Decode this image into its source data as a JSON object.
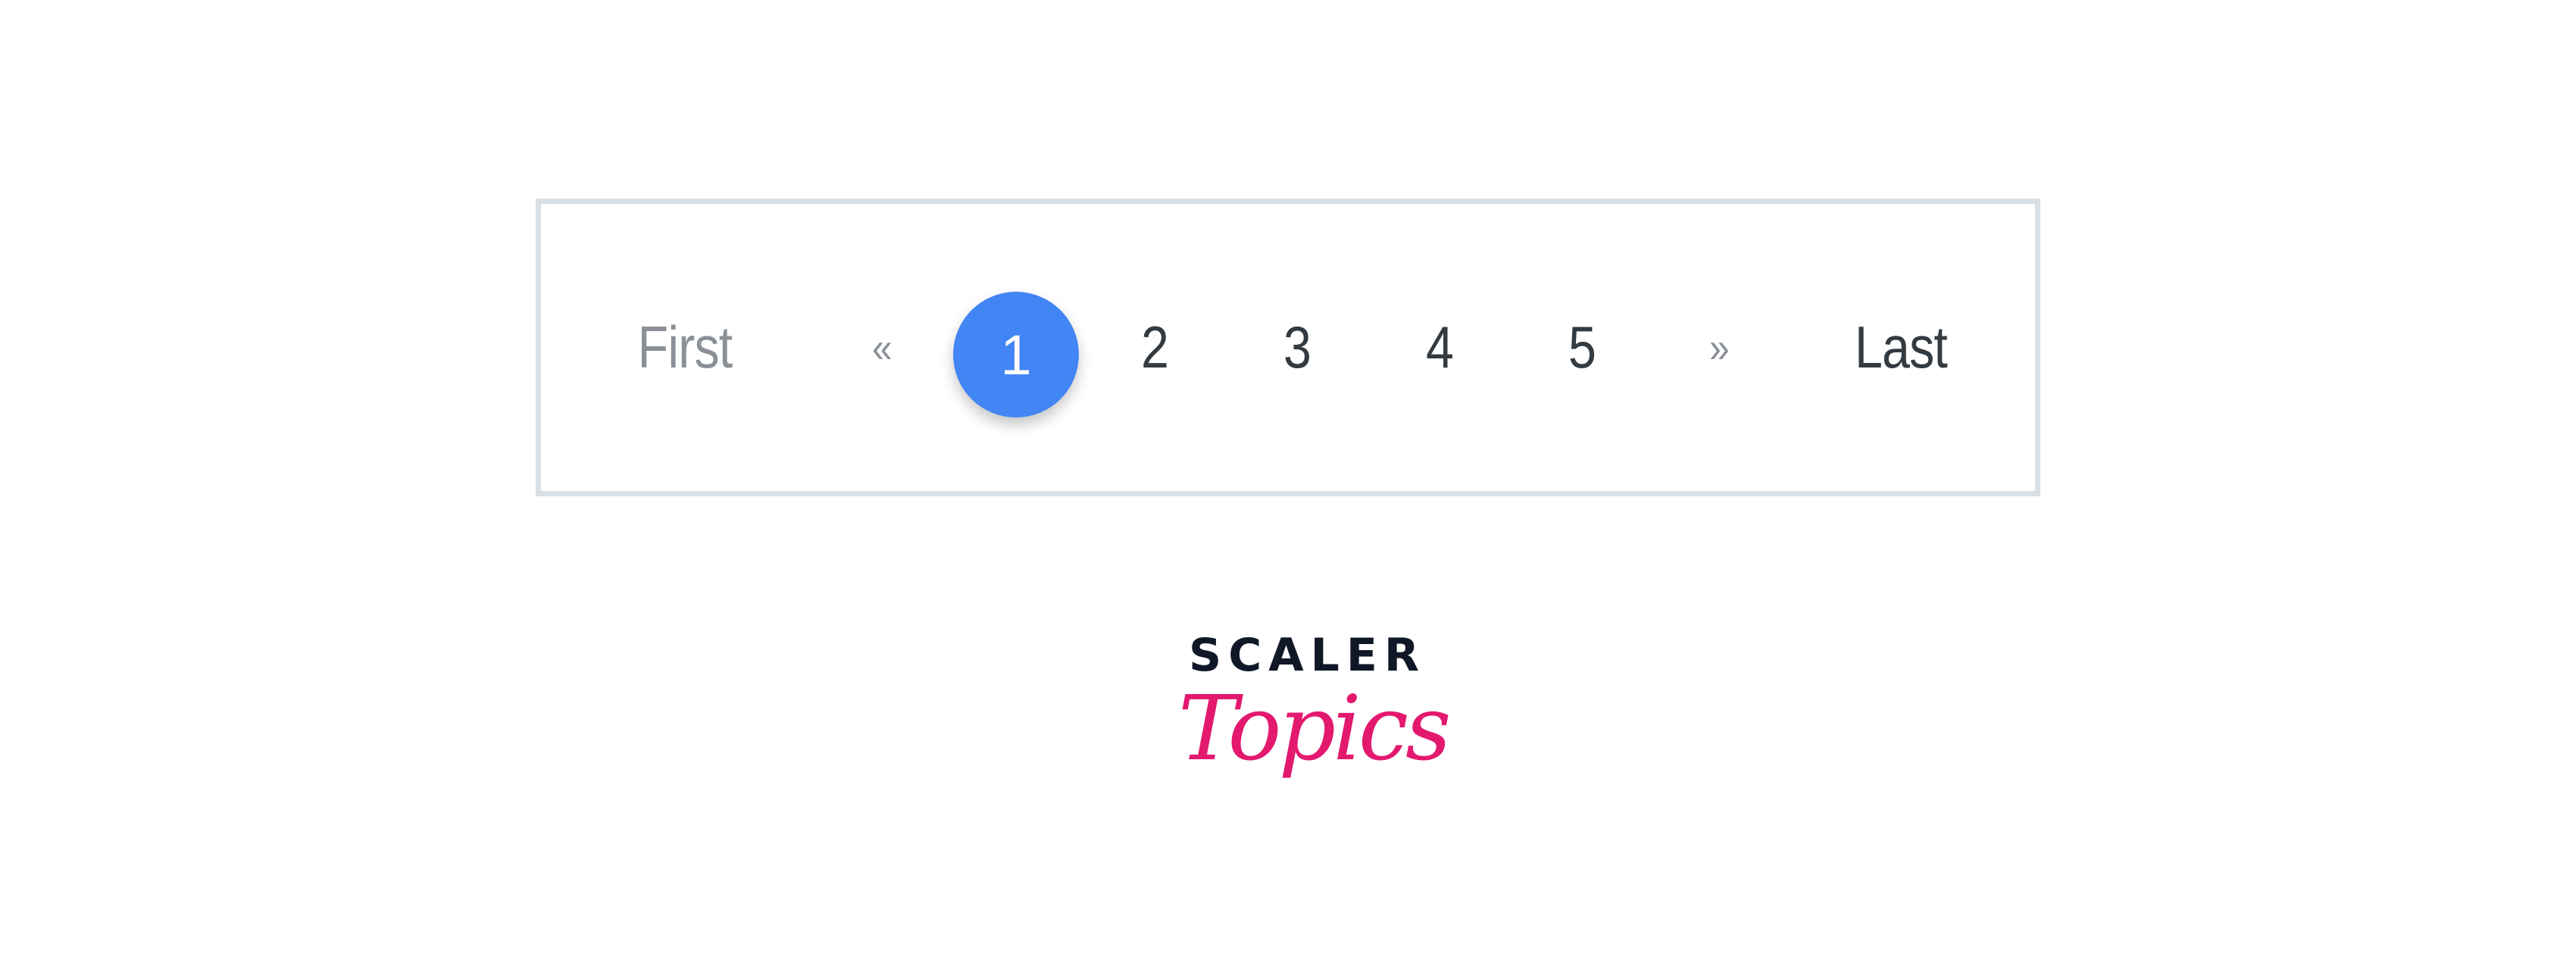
{
  "pagination": {
    "first_label": "First",
    "prev_label": "«",
    "pages": [
      "1",
      "2",
      "3",
      "4",
      "5"
    ],
    "current_page": "1",
    "next_label": "»",
    "last_label": "Last",
    "active_color": "#4285f4"
  },
  "logo": {
    "line1": "SCALER",
    "line2": "Topics",
    "line1_color": "#101828",
    "line2_color": "#e3196f"
  }
}
